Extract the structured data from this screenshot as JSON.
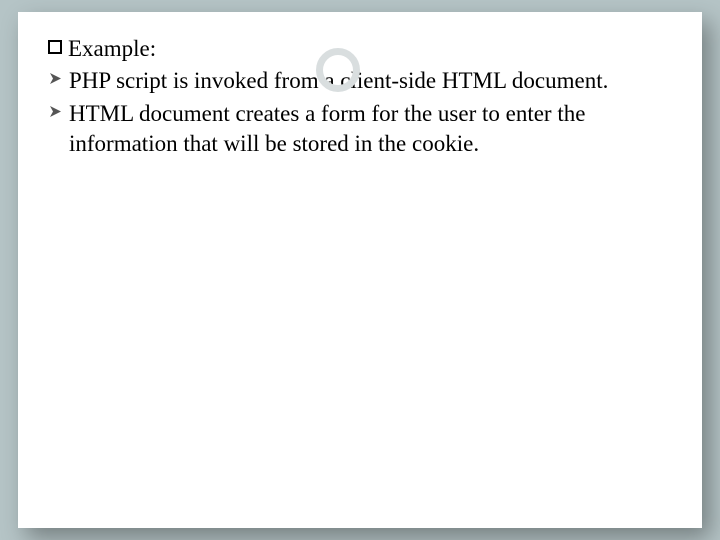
{
  "slide": {
    "heading": "Example:",
    "bullets": [
      "PHP script is invoked from a client-side HTML document.",
      "HTML document creates a form for the user to enter the information that will be stored in the cookie."
    ]
  }
}
